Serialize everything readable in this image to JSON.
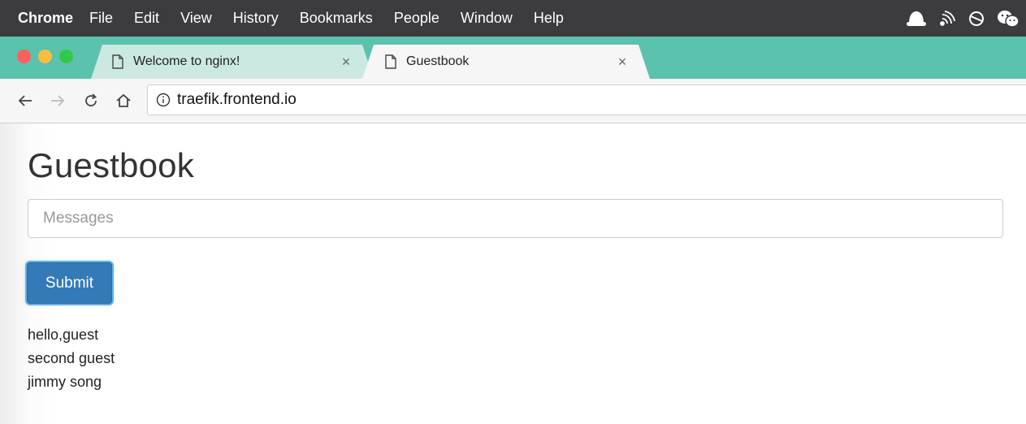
{
  "menubar": {
    "app": "Chrome",
    "items": [
      "File",
      "Edit",
      "View",
      "History",
      "Bookmarks",
      "People",
      "Window",
      "Help"
    ],
    "tray_icons": [
      "ghost-icon",
      "broadcast-icon",
      "sync-icon",
      "wechat-icon"
    ]
  },
  "tabs": [
    {
      "title": "Welcome to nginx!",
      "active": false,
      "close": "×"
    },
    {
      "title": "Guestbook",
      "active": true,
      "close": "×"
    }
  ],
  "toolbar": {
    "url": "traefik.frontend.io"
  },
  "page": {
    "heading": "Guestbook",
    "input_placeholder": "Messages",
    "submit_label": "Submit",
    "entries": [
      "hello,guest",
      "second guest",
      "jimmy song"
    ]
  },
  "colors": {
    "menubar_bg": "#3c3c3e",
    "tabstrip_bg": "#5bc2ad",
    "button_primary": "#337ab7",
    "traffic_red": "#fc605c",
    "traffic_yellow": "#fdbc40",
    "traffic_green": "#34c84a"
  }
}
